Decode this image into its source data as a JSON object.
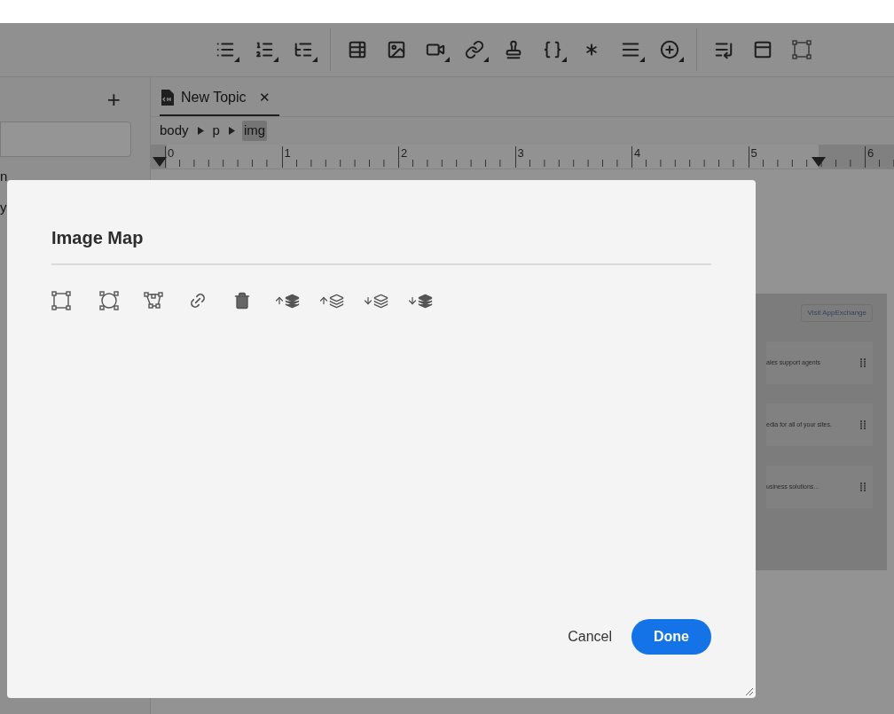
{
  "toolbar": [
    {
      "kind": "bullet-list",
      "has_menu": true
    },
    {
      "kind": "numbered-list",
      "has_menu": true
    },
    {
      "kind": "nested-list",
      "has_menu": true
    },
    {
      "kind": "separator"
    },
    {
      "kind": "insert-table",
      "has_menu": false
    },
    {
      "kind": "image",
      "has_menu": false
    },
    {
      "kind": "video",
      "has_menu": true
    },
    {
      "kind": "link",
      "has_menu": true
    },
    {
      "kind": "bookmark-pen",
      "has_menu": false
    },
    {
      "kind": "braces",
      "has_menu": true
    },
    {
      "kind": "burst",
      "has_menu": false
    },
    {
      "kind": "lines",
      "has_menu": true
    },
    {
      "kind": "add",
      "has_menu": true
    },
    {
      "kind": "separator"
    },
    {
      "kind": "indent-list",
      "has_menu": false
    },
    {
      "kind": "panel",
      "has_menu": false
    },
    {
      "kind": "frame",
      "has_menu": false
    }
  ],
  "sidebar": {
    "add": "+",
    "items": [
      "n",
      "y"
    ]
  },
  "tabs": [
    {
      "label": "New Topic",
      "close": "✕",
      "selected": true
    }
  ],
  "breadcrumb": [
    {
      "label": "body",
      "selected": false
    },
    {
      "label": "p",
      "selected": false
    },
    {
      "label": "img",
      "selected": true
    }
  ],
  "ruler": {
    "labels": [
      "0",
      "1",
      "2",
      "3",
      "4",
      "5",
      "6"
    ]
  },
  "embedded_page": {
    "button": "Visit AppExchange",
    "lines": [
      "ales support agents",
      "edia for all of your sites.",
      "usiness solutions..."
    ]
  },
  "dialog": {
    "title": "Image Map",
    "tools": [
      {
        "kind": "rectangle"
      },
      {
        "kind": "circle"
      },
      {
        "kind": "polygon"
      },
      {
        "kind": "link"
      },
      {
        "kind": "delete"
      },
      {
        "kind": "bring-front"
      },
      {
        "kind": "bring-forward"
      },
      {
        "kind": "send-backward"
      },
      {
        "kind": "send-back"
      }
    ],
    "cancel": "Cancel",
    "done": "Done"
  }
}
